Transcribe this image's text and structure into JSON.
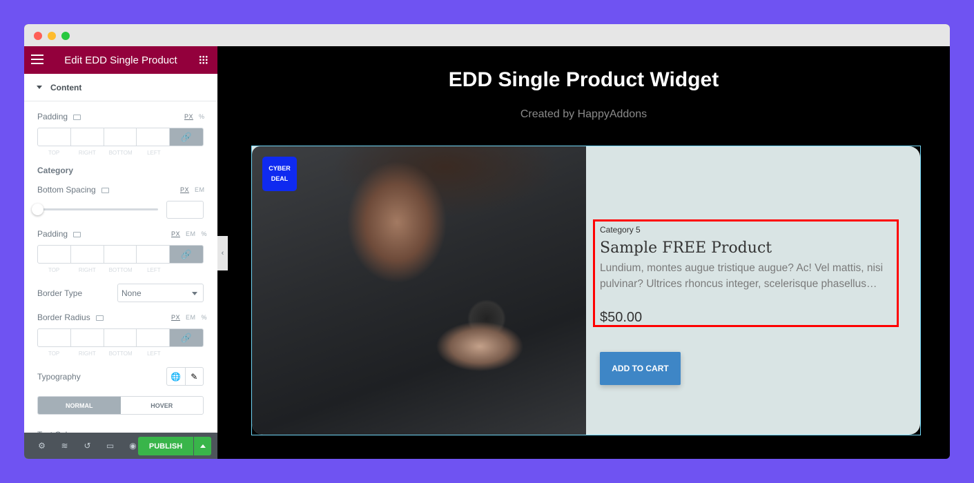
{
  "window": {
    "controls": [
      "close",
      "minimize",
      "maximize"
    ]
  },
  "sidebar": {
    "title": "Edit EDD Single Product",
    "section": "Content",
    "padding1": {
      "label": "Padding",
      "units": [
        "PX",
        "%"
      ],
      "active_unit": "PX",
      "sides": [
        "TOP",
        "RIGHT",
        "BOTTOM",
        "LEFT"
      ]
    },
    "category_heading": "Category",
    "bottom_spacing": {
      "label": "Bottom Spacing",
      "units": [
        "PX",
        "EM"
      ],
      "value": 0
    },
    "padding2": {
      "label": "Padding",
      "units": [
        "PX",
        "EM",
        "%"
      ],
      "sides": [
        "TOP",
        "RIGHT",
        "BOTTOM",
        "LEFT"
      ]
    },
    "border_type": {
      "label": "Border Type",
      "value": "None"
    },
    "border_radius": {
      "label": "Border Radius",
      "units": [
        "PX",
        "EM",
        "%"
      ],
      "sides": [
        "TOP",
        "RIGHT",
        "BOTTOM",
        "LEFT"
      ]
    },
    "typography": {
      "label": "Typography"
    },
    "state_tabs": [
      "NORMAL",
      "HOVER"
    ],
    "next_label": "Text Color",
    "footer": {
      "publish": "PUBLISH",
      "icons": [
        "gear-icon",
        "layers-icon",
        "history-icon",
        "responsive-icon",
        "eye-icon"
      ]
    }
  },
  "canvas": {
    "title": "EDD Single Product Widget",
    "subtitle": "Created by HappyAddons",
    "product": {
      "badge_line1": "CYBER",
      "badge_line2": "DEAL",
      "category": "Category 5",
      "name": "Sample FREE Product",
      "description": "Lundium, montes augue tristique augue? Ac! Vel mattis, nisi pulvinar? Ultrices rhoncus integer, scelerisque phasellus…",
      "price": "$50.00",
      "button": "ADD TO CART"
    }
  },
  "colors": {
    "header": "#93003c",
    "publish": "#39b54a",
    "badge": "#0f2af0",
    "cart_button": "#3e86c6",
    "highlight": "#ff0000",
    "background": "#6f53f2"
  }
}
